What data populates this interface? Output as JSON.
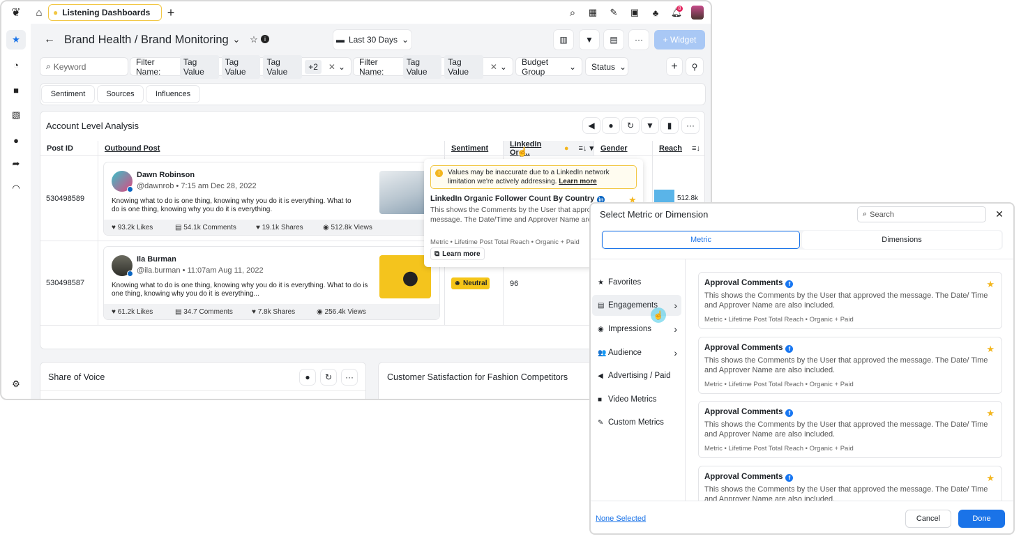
{
  "topbar": {
    "tab_label": "Listening Dashboards",
    "notification_count": "8"
  },
  "header": {
    "title": "Brand Health / Brand Monitoring",
    "date_range": "Last 30 Days",
    "widget_button": "+ Widget"
  },
  "filters": {
    "keyword_placeholder": "Keyword",
    "filter1": {
      "label": "Filter Name:",
      "chips": [
        "Tag Value",
        "Tag Value",
        "Tag Value"
      ],
      "more": "+2"
    },
    "filter2": {
      "label": "Filter Name:",
      "chips": [
        "Tag Value",
        "Tag Value"
      ]
    },
    "budget_group": "Budget Group",
    "status": "Status"
  },
  "tabs": [
    "Sentiment",
    "Sources",
    "Influences"
  ],
  "widget": {
    "title": "Account Level Analysis",
    "columns": [
      "Post ID",
      "Outbound Post",
      "Sentiment",
      "LinkedIn Org...",
      "Gender",
      "Reach"
    ],
    "rows": [
      {
        "post_id": "530498589",
        "author": "Dawn Robinson",
        "meta": "@dawnrob • 7:15 am Dec 28, 2022",
        "text": "Knowing what to do is one thing, knowing why you do it is everything. What to do is one thing, knowing why you do it is everything.",
        "likes": "93.2k Likes",
        "comments": "54.1k Comments",
        "shares": "19.1k Shares",
        "views": "512.8k Views",
        "reach": "512.8k",
        "reach_fraction": 0.8
      },
      {
        "post_id": "530498587",
        "author": "Ila Burman",
        "meta": "@ila.burman • 11:07am Aug 11, 2022",
        "text": "Knowing what to do is one thing, knowing why you do it is everything. What to do is one thing, knowing why you do it is everything...",
        "likes": "61.2k Likes",
        "comments": "34.7 Comments",
        "shares": "7.8k Shares",
        "views": "256.4k Views",
        "sentiment": "Neutral",
        "linkedin": "96"
      }
    ]
  },
  "tooltip": {
    "warning": "Values may be inaccurate due to a LinkedIn network limitation we're actively addressing.",
    "warning_link": "Learn more",
    "title": "LinkedIn Organic Follower Count By Country",
    "desc": "This shows the Comments by the User that approved the message. The Date/Time and Approver Name are also included.",
    "meta": "Metric • Lifetime Post Total Reach •  Organic + Paid",
    "learn_more": "Learn more"
  },
  "bottom_widgets": [
    "Share of Voice",
    "Customer Satisfaction for Fashion Competitors"
  ],
  "modal": {
    "title": "Select Metric or Dimension",
    "search_placeholder": "Search",
    "tabs": [
      "Metric",
      "Dimensions"
    ],
    "active_tab": "Metric",
    "categories": [
      {
        "label": "Favorites",
        "icon": "star-icon",
        "g": "★"
      },
      {
        "label": "Engagements",
        "icon": "comment-icon",
        "g": "▤",
        "chev": true
      },
      {
        "label": "Impressions",
        "icon": "eye-icon",
        "g": "◉",
        "chev": true
      },
      {
        "label": "Audience",
        "icon": "users-icon",
        "g": "👥",
        "chev": true
      },
      {
        "label": "Advertising / Paid",
        "icon": "megaphone-icon",
        "g": "◀"
      },
      {
        "label": "Video Metrics",
        "icon": "video-icon",
        "g": "■"
      },
      {
        "label": "Custom Metrics",
        "icon": "edit-icon",
        "g": "✎"
      }
    ],
    "active_category": "Engagements",
    "metrics": [
      {
        "title": "Approval Comments",
        "desc": "This shows the Comments by the User that approved the message. The Date/ Time and Approver Name are also included.",
        "meta": "Metric • Lifetime Post Total Reach • Organic + Paid"
      },
      {
        "title": "Approval Comments",
        "desc": "This shows the Comments by the User that approved the message. The Date/ Time and Approver Name are also included.",
        "meta": "Metric • Lifetime Post Total Reach • Organic + Paid"
      },
      {
        "title": "Approval Comments",
        "desc": "This shows the Comments by the User that approved the message. The Date/ Time and Approver Name are also included.",
        "meta": "Metric • Lifetime Post Total Reach • Organic + Paid"
      },
      {
        "title": "Approval Comments",
        "desc": "This shows the Comments by the User that approved the message. The Date/ Time and Approver Name are also included.",
        "meta": "Metric • Lifetime Post Total Reach • Organic + Paid"
      }
    ],
    "none_selected": "None Selected",
    "cancel": "Cancel",
    "done": "Done"
  },
  "colors": {
    "accent": "#1a73e8",
    "widget_button": "#a9c8f5",
    "neutral": "#f5c518",
    "reach_bar": "#5ab4e8",
    "star": "#f3b61f"
  }
}
